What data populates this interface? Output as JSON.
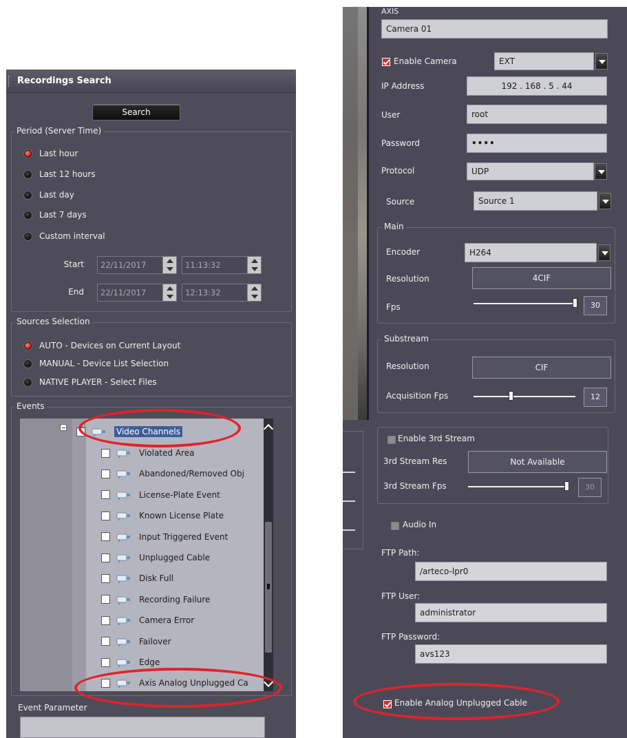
{
  "left": {
    "panel_title": "Recordings Search",
    "search_label": "Search",
    "period": {
      "title": "Period (Server Time)",
      "options": [
        "Last hour",
        "Last 12 hours",
        "Last day",
        "Last 7 days",
        "Custom interval"
      ],
      "selected_index": 0,
      "start_label": "Start",
      "start_date": "22/11/2017",
      "start_time": "11:13:32",
      "end_label": "End",
      "end_date": "22/11/2017",
      "end_time": "12:13:32"
    },
    "sources": {
      "title": "Sources Selection",
      "options": [
        "AUTO - Devices on Current Layout",
        "MANUAL - Device List Selection",
        "NATIVE PLAYER - Select Files"
      ],
      "selected_index": 0
    },
    "events": {
      "title": "Events",
      "root_label": "Video Channels",
      "items": [
        "Violated Area",
        "Abandoned/Removed Obj",
        "License-Plate Event",
        "Known License Plate",
        "Input Triggered Event",
        "Unplugged Cable",
        "Disk Full",
        "Recording Failure",
        "Camera Error",
        "Failover",
        "Edge",
        "Axis Analog Unplugged Ca"
      ]
    },
    "event_parameter_label": "Event Parameter"
  },
  "right": {
    "brand": "AXIS",
    "camera_name": "Camera 01",
    "enable_camera_label": "Enable Camera",
    "camera_type": "EXT",
    "ip_label": "IP Address",
    "ip_value": "192 . 168 . 5 . 44",
    "user_label": "User",
    "user_value": "root",
    "password_label": "Password",
    "password_value": "••••",
    "protocol_label": "Protocol",
    "protocol_value": "UDP",
    "source_label": "Source",
    "source_value": "Source 1",
    "main": {
      "title": "Main",
      "encoder_label": "Encoder",
      "encoder_value": "H264",
      "resolution_label": "Resolution",
      "resolution_value": "4CIF",
      "fps_label": "Fps",
      "fps_value": "30"
    },
    "substream": {
      "title": "Substream",
      "resolution_label": "Resolution",
      "resolution_value": "CIF",
      "acq_fps_label": "Acquisition Fps",
      "acq_fps_value": "12"
    },
    "third": {
      "enable_label": "Enable 3rd Stream",
      "res_label": "3rd Stream Res",
      "res_value": "Not Available",
      "fps_label": "3rd Stream Fps",
      "fps_value": "30"
    },
    "audio_in_label": "Audio In",
    "ftp_path_label": "FTP Path:",
    "ftp_path_value": "/arteco-lpr0",
    "ftp_user_label": "FTP User:",
    "ftp_user_value": "administrator",
    "ftp_password_label": "FTP Password:",
    "ftp_password_value": "avs123",
    "enable_analog_label": "Enable Analog Unplugged Cable"
  },
  "colors": {
    "panel_bg": "#4e4c58",
    "highlight_red": "#e0232b",
    "radio_selected": "#d22222"
  }
}
